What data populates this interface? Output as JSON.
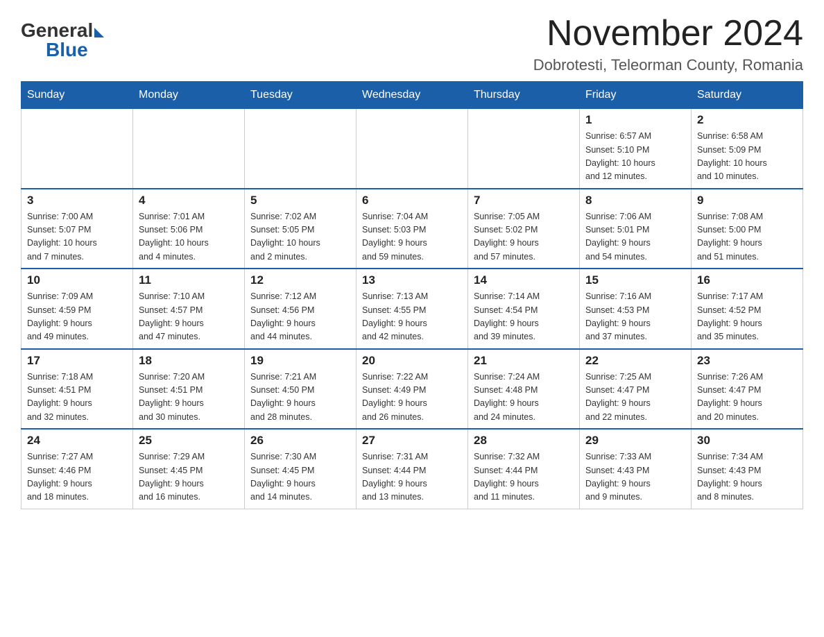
{
  "logo": {
    "general": "General",
    "blue": "Blue"
  },
  "title": "November 2024",
  "location": "Dobrotesti, Teleorman County, Romania",
  "days_of_week": [
    "Sunday",
    "Monday",
    "Tuesday",
    "Wednesday",
    "Thursday",
    "Friday",
    "Saturday"
  ],
  "weeks": [
    [
      {
        "day": "",
        "info": ""
      },
      {
        "day": "",
        "info": ""
      },
      {
        "day": "",
        "info": ""
      },
      {
        "day": "",
        "info": ""
      },
      {
        "day": "",
        "info": ""
      },
      {
        "day": "1",
        "info": "Sunrise: 6:57 AM\nSunset: 5:10 PM\nDaylight: 10 hours\nand 12 minutes."
      },
      {
        "day": "2",
        "info": "Sunrise: 6:58 AM\nSunset: 5:09 PM\nDaylight: 10 hours\nand 10 minutes."
      }
    ],
    [
      {
        "day": "3",
        "info": "Sunrise: 7:00 AM\nSunset: 5:07 PM\nDaylight: 10 hours\nand 7 minutes."
      },
      {
        "day": "4",
        "info": "Sunrise: 7:01 AM\nSunset: 5:06 PM\nDaylight: 10 hours\nand 4 minutes."
      },
      {
        "day": "5",
        "info": "Sunrise: 7:02 AM\nSunset: 5:05 PM\nDaylight: 10 hours\nand 2 minutes."
      },
      {
        "day": "6",
        "info": "Sunrise: 7:04 AM\nSunset: 5:03 PM\nDaylight: 9 hours\nand 59 minutes."
      },
      {
        "day": "7",
        "info": "Sunrise: 7:05 AM\nSunset: 5:02 PM\nDaylight: 9 hours\nand 57 minutes."
      },
      {
        "day": "8",
        "info": "Sunrise: 7:06 AM\nSunset: 5:01 PM\nDaylight: 9 hours\nand 54 minutes."
      },
      {
        "day": "9",
        "info": "Sunrise: 7:08 AM\nSunset: 5:00 PM\nDaylight: 9 hours\nand 51 minutes."
      }
    ],
    [
      {
        "day": "10",
        "info": "Sunrise: 7:09 AM\nSunset: 4:59 PM\nDaylight: 9 hours\nand 49 minutes."
      },
      {
        "day": "11",
        "info": "Sunrise: 7:10 AM\nSunset: 4:57 PM\nDaylight: 9 hours\nand 47 minutes."
      },
      {
        "day": "12",
        "info": "Sunrise: 7:12 AM\nSunset: 4:56 PM\nDaylight: 9 hours\nand 44 minutes."
      },
      {
        "day": "13",
        "info": "Sunrise: 7:13 AM\nSunset: 4:55 PM\nDaylight: 9 hours\nand 42 minutes."
      },
      {
        "day": "14",
        "info": "Sunrise: 7:14 AM\nSunset: 4:54 PM\nDaylight: 9 hours\nand 39 minutes."
      },
      {
        "day": "15",
        "info": "Sunrise: 7:16 AM\nSunset: 4:53 PM\nDaylight: 9 hours\nand 37 minutes."
      },
      {
        "day": "16",
        "info": "Sunrise: 7:17 AM\nSunset: 4:52 PM\nDaylight: 9 hours\nand 35 minutes."
      }
    ],
    [
      {
        "day": "17",
        "info": "Sunrise: 7:18 AM\nSunset: 4:51 PM\nDaylight: 9 hours\nand 32 minutes."
      },
      {
        "day": "18",
        "info": "Sunrise: 7:20 AM\nSunset: 4:51 PM\nDaylight: 9 hours\nand 30 minutes."
      },
      {
        "day": "19",
        "info": "Sunrise: 7:21 AM\nSunset: 4:50 PM\nDaylight: 9 hours\nand 28 minutes."
      },
      {
        "day": "20",
        "info": "Sunrise: 7:22 AM\nSunset: 4:49 PM\nDaylight: 9 hours\nand 26 minutes."
      },
      {
        "day": "21",
        "info": "Sunrise: 7:24 AM\nSunset: 4:48 PM\nDaylight: 9 hours\nand 24 minutes."
      },
      {
        "day": "22",
        "info": "Sunrise: 7:25 AM\nSunset: 4:47 PM\nDaylight: 9 hours\nand 22 minutes."
      },
      {
        "day": "23",
        "info": "Sunrise: 7:26 AM\nSunset: 4:47 PM\nDaylight: 9 hours\nand 20 minutes."
      }
    ],
    [
      {
        "day": "24",
        "info": "Sunrise: 7:27 AM\nSunset: 4:46 PM\nDaylight: 9 hours\nand 18 minutes."
      },
      {
        "day": "25",
        "info": "Sunrise: 7:29 AM\nSunset: 4:45 PM\nDaylight: 9 hours\nand 16 minutes."
      },
      {
        "day": "26",
        "info": "Sunrise: 7:30 AM\nSunset: 4:45 PM\nDaylight: 9 hours\nand 14 minutes."
      },
      {
        "day": "27",
        "info": "Sunrise: 7:31 AM\nSunset: 4:44 PM\nDaylight: 9 hours\nand 13 minutes."
      },
      {
        "day": "28",
        "info": "Sunrise: 7:32 AM\nSunset: 4:44 PM\nDaylight: 9 hours\nand 11 minutes."
      },
      {
        "day": "29",
        "info": "Sunrise: 7:33 AM\nSunset: 4:43 PM\nDaylight: 9 hours\nand 9 minutes."
      },
      {
        "day": "30",
        "info": "Sunrise: 7:34 AM\nSunset: 4:43 PM\nDaylight: 9 hours\nand 8 minutes."
      }
    ]
  ]
}
